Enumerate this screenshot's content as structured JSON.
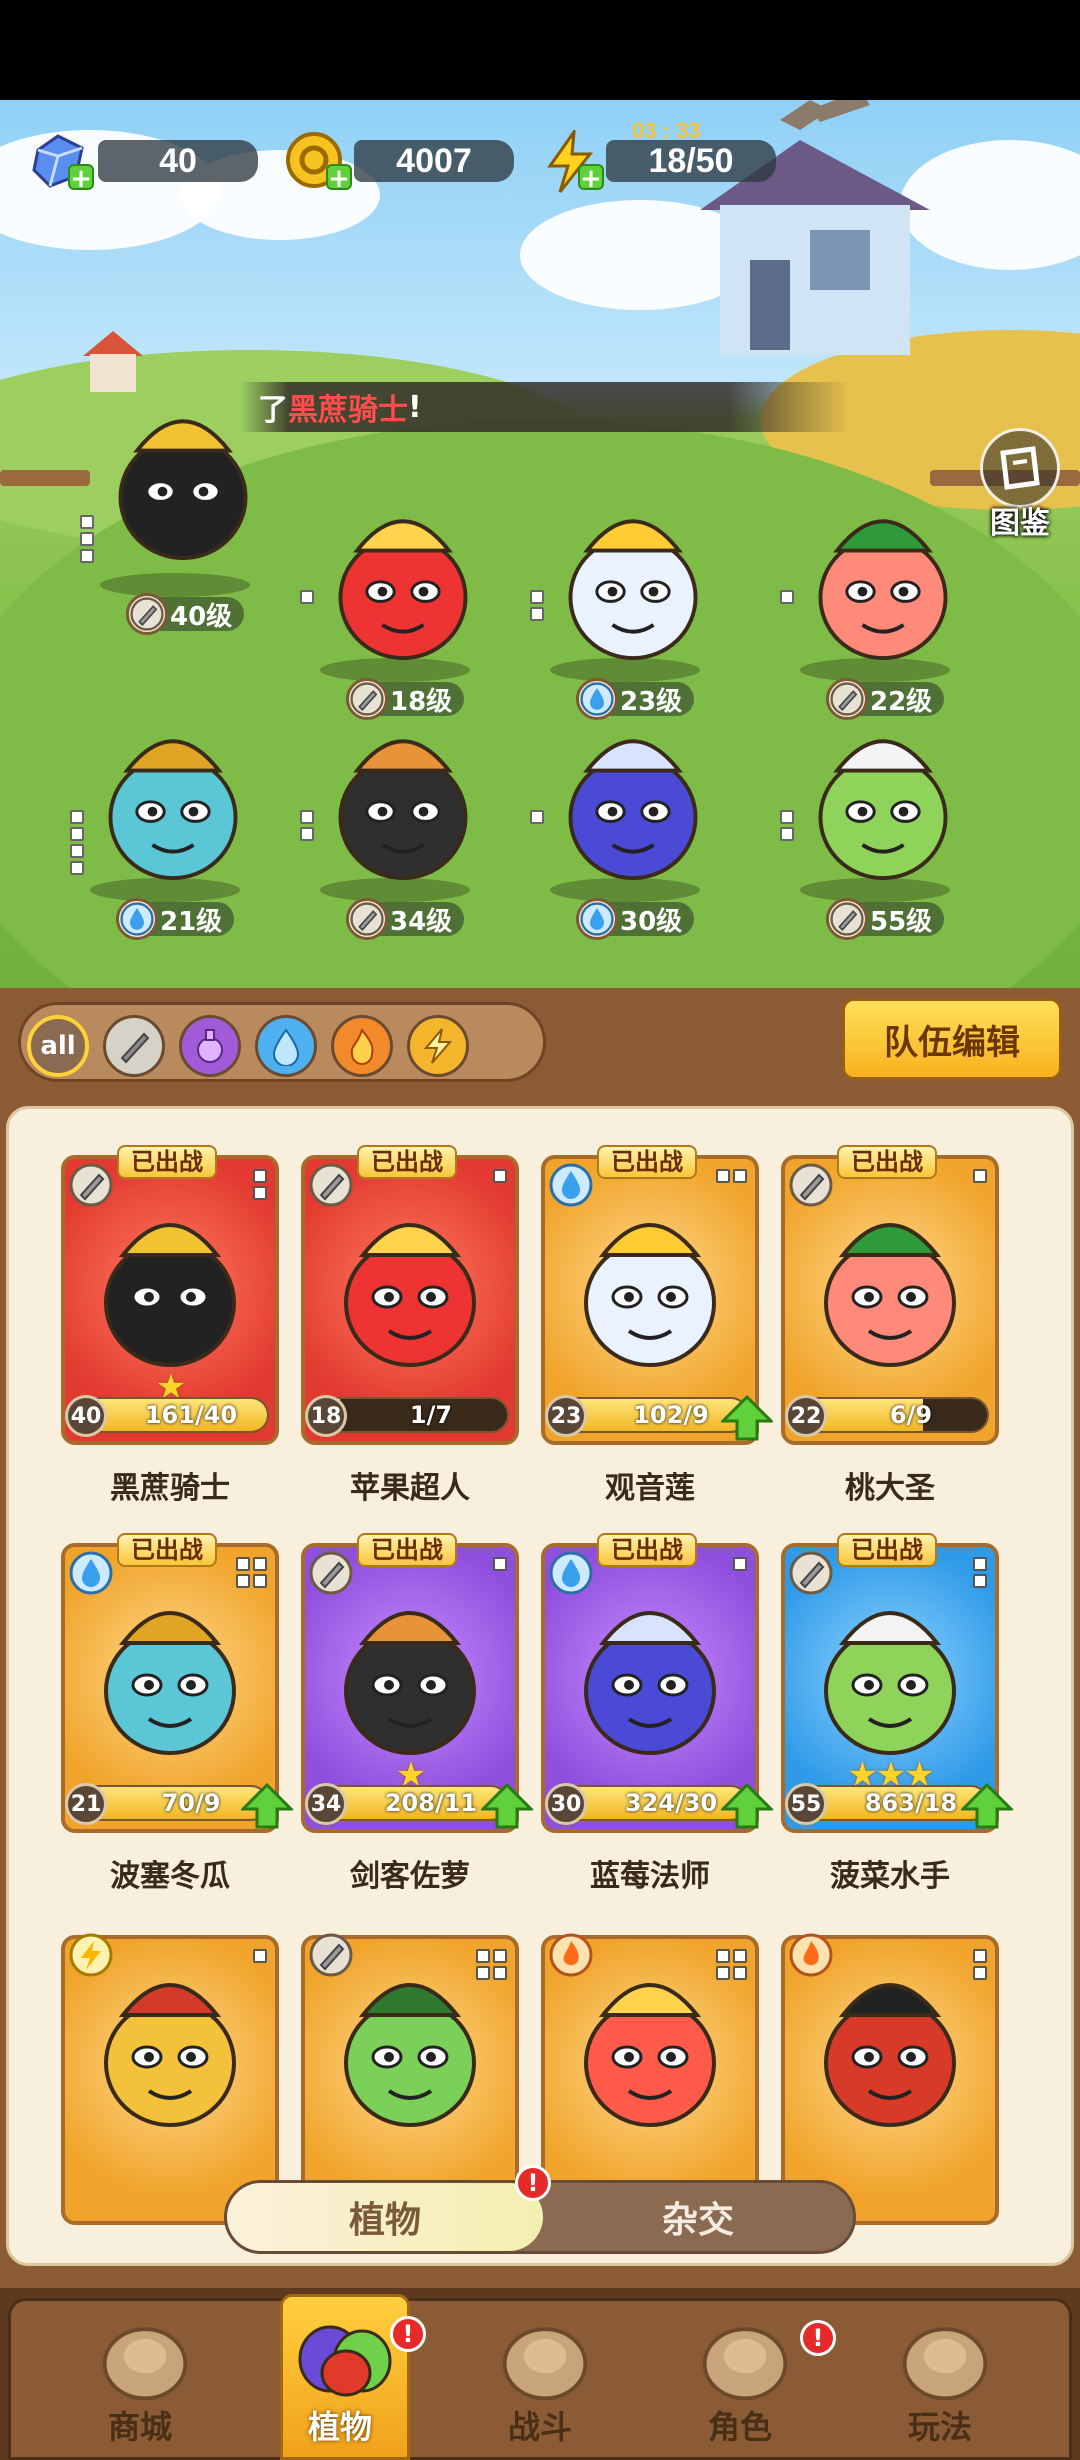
{
  "resources": {
    "gems": "40",
    "coins": "4007",
    "energy": "18/50",
    "energy_timer": "03 : 33"
  },
  "announcement": {
    "prefix": "了",
    "highlight": "黑蔗骑士",
    "suffix": "!"
  },
  "codex_label": "图鉴",
  "scene_characters": [
    {
      "name": "黑蔗骑士",
      "level": "40级",
      "element": "sword"
    },
    {
      "name": "苹果超人",
      "level": "18级",
      "element": "sword"
    },
    {
      "name": "观音莲",
      "level": "23级",
      "element": "water"
    },
    {
      "name": "桃大圣",
      "level": "22级",
      "element": "sword"
    },
    {
      "name": "波塞冬瓜",
      "level": "21级",
      "element": "water"
    },
    {
      "name": "剑客佐萝",
      "level": "34级",
      "element": "sword"
    },
    {
      "name": "蓝莓法师",
      "level": "30级",
      "element": "water"
    },
    {
      "name": "菠菜水手",
      "level": "55级",
      "element": "sword"
    }
  ],
  "filters": [
    "all",
    "sword",
    "potion",
    "water",
    "fire",
    "lightning"
  ],
  "filters_label_all": "all",
  "team_edit_label": "队伍编辑",
  "deployed_label": "已出战",
  "cards": [
    {
      "name": "黑蔗骑士",
      "level": "40",
      "progress": "161/40",
      "fill": 1.0,
      "stars": "★",
      "color": "red",
      "element": "sword",
      "upgrade": false
    },
    {
      "name": "苹果超人",
      "level": "18",
      "progress": "1/7",
      "fill": 0.14,
      "stars": "",
      "color": "red",
      "element": "sword",
      "upgrade": false
    },
    {
      "name": "观音莲",
      "level": "23",
      "progress": "102/9",
      "fill": 1.0,
      "stars": "",
      "color": "gold",
      "element": "water",
      "upgrade": true
    },
    {
      "name": "桃大圣",
      "level": "22",
      "progress": "6/9",
      "fill": 0.67,
      "stars": "",
      "color": "gold",
      "element": "sword",
      "upgrade": false
    },
    {
      "name": "波塞冬瓜",
      "level": "21",
      "progress": "70/9",
      "fill": 1.0,
      "stars": "",
      "color": "gold",
      "element": "water",
      "upgrade": true
    },
    {
      "name": "剑客佐萝",
      "level": "34",
      "progress": "208/11",
      "fill": 1.0,
      "stars": "★",
      "color": "purple",
      "element": "sword",
      "upgrade": true
    },
    {
      "name": "蓝莓法师",
      "level": "30",
      "progress": "324/30",
      "fill": 1.0,
      "stars": "",
      "color": "purple",
      "element": "water",
      "upgrade": true
    },
    {
      "name": "菠菜水手",
      "level": "55",
      "progress": "863/18",
      "fill": 1.0,
      "stars": "★★★",
      "color": "blue",
      "element": "sword",
      "upgrade": true
    }
  ],
  "partial_cards": [
    {
      "color": "gold",
      "element": "lightning"
    },
    {
      "color": "gold",
      "element": "sword"
    },
    {
      "color": "gold",
      "element": "fire"
    },
    {
      "color": "gold",
      "element": "fire"
    }
  ],
  "toggle": {
    "active": "植物",
    "inactive": "杂交"
  },
  "nav": [
    {
      "label": "商城",
      "active": false,
      "alert": false
    },
    {
      "label": "植物",
      "active": true,
      "alert": true
    },
    {
      "label": "战斗",
      "active": false,
      "alert": false
    },
    {
      "label": "角色",
      "active": false,
      "alert": true
    },
    {
      "label": "玩法",
      "active": false,
      "alert": false
    }
  ],
  "colors": {
    "panel_brown": "#8a5b34",
    "accent_gold": "#f7b11e",
    "alert_red": "#e62a2a"
  }
}
